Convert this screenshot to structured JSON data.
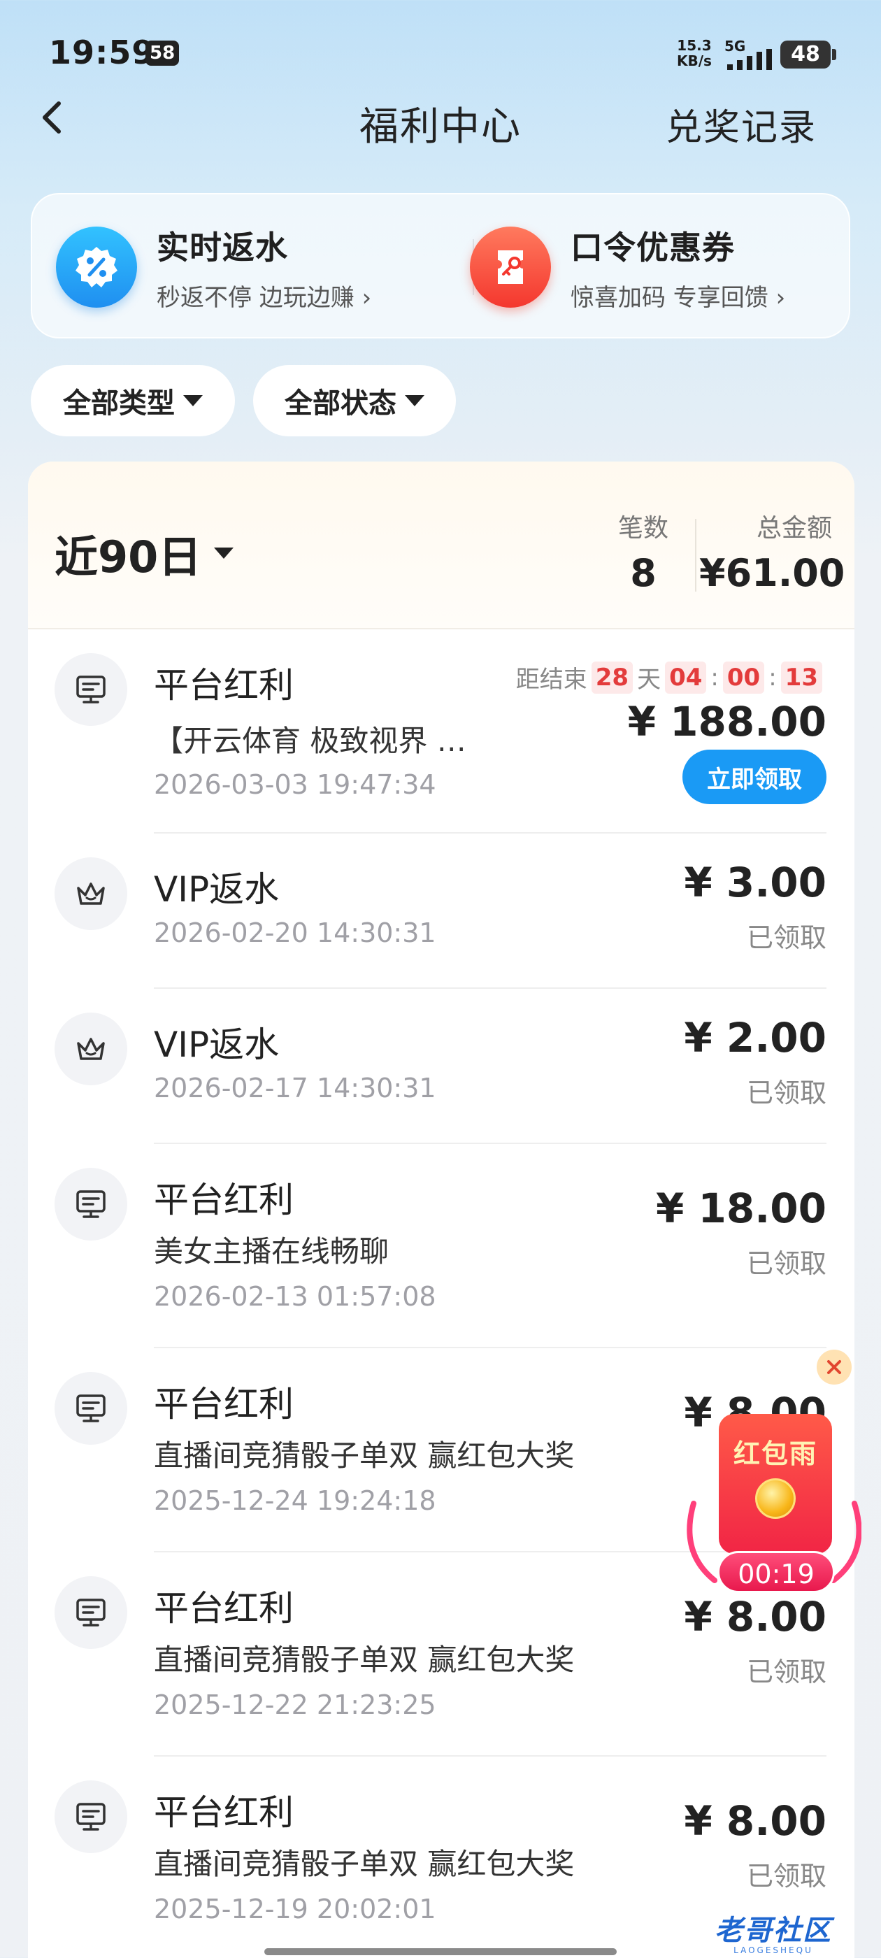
{
  "status_bar": {
    "time": "19:59",
    "time_badge": "58",
    "net_speed_value": "15.3",
    "net_speed_unit": "KB/s",
    "network_type": "5G",
    "battery": "48"
  },
  "header": {
    "title": "福利中心",
    "records_link": "兑奖记录",
    "back_icon": "chevron-left-icon"
  },
  "promos": [
    {
      "title": "实时返水",
      "subtitle": "秒返不停 边玩边赚",
      "icon": "percent-badge-icon",
      "color": "#1f8ff0"
    },
    {
      "title": "口令优惠券",
      "subtitle": "惊喜加码 专享回馈",
      "icon": "key-ticket-icon",
      "color": "#f4372e"
    }
  ],
  "filters": {
    "type_label": "全部类型",
    "status_label": "全部状态"
  },
  "summary": {
    "period": "近90日",
    "count_label": "笔数",
    "count_value": "8",
    "total_label": "总金额",
    "total_value": "¥61.00"
  },
  "countdown": {
    "prefix": "距结束",
    "days": "28",
    "days_unit": "天",
    "hours": "04",
    "minutes": "00",
    "seconds": "13",
    "sep": ":"
  },
  "claim_button": "立即领取",
  "records": [
    {
      "icon": "monitor-icon",
      "title": "平台红利",
      "desc": "【开云体育 极致视界 …",
      "date": "2026-03-03 19:47:34",
      "amount": "¥ 188.00",
      "status": ""
    },
    {
      "icon": "crown-icon",
      "title": "VIP返水",
      "desc": "",
      "date": "2026-02-20 14:30:31",
      "amount": "¥ 3.00",
      "status": "已领取"
    },
    {
      "icon": "crown-icon",
      "title": "VIP返水",
      "desc": "",
      "date": "2026-02-17 14:30:31",
      "amount": "¥ 2.00",
      "status": "已领取"
    },
    {
      "icon": "monitor-icon",
      "title": "平台红利",
      "desc": "美女主播在线畅聊",
      "date": "2026-02-13 01:57:08",
      "amount": "¥ 18.00",
      "status": "已领取"
    },
    {
      "icon": "monitor-icon",
      "title": "平台红利",
      "desc": "直播间竞猜骰子单双 赢红包大奖",
      "date": "2025-12-24 19:24:18",
      "amount": "¥ 8.00",
      "status": ""
    },
    {
      "icon": "monitor-icon",
      "title": "平台红利",
      "desc": "直播间竞猜骰子单双 赢红包大奖",
      "date": "2025-12-22 21:23:25",
      "amount": "¥ 8.00",
      "status": "已领取"
    },
    {
      "icon": "monitor-icon",
      "title": "平台红利",
      "desc": "直播间竞猜骰子单双 赢红包大奖",
      "date": "2025-12-19 20:02:01",
      "amount": "¥ 8.00",
      "status": "已领取"
    }
  ],
  "red_packet": {
    "title": "红包雨",
    "timer": "00:19",
    "close_icon": "close-icon"
  },
  "watermark": {
    "main": "老哥社区",
    "sub": "LAOGESHEQU"
  }
}
